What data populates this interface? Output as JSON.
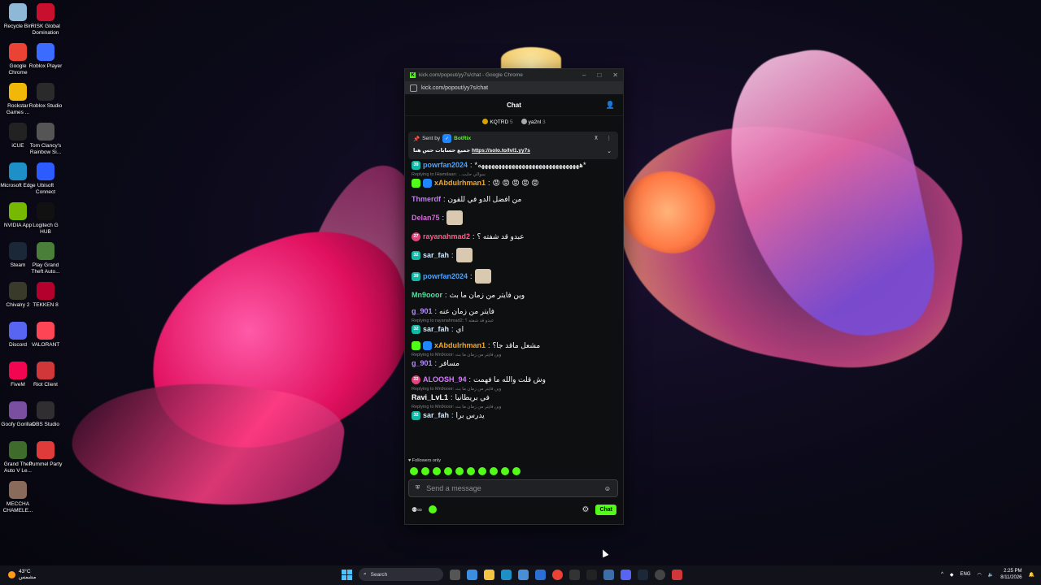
{
  "desktop_icons": [
    {
      "label": "Recycle Bin",
      "color": "#8fb7d6"
    },
    {
      "label": "RISK Global Domination",
      "color": "#c8102e"
    },
    {
      "label": "Google Chrome",
      "color": "#ea4335"
    },
    {
      "label": "Roblox Player",
      "color": "#3b6cff"
    },
    {
      "label": "Rockstar Games ...",
      "color": "#f2b807"
    },
    {
      "label": "Roblox Studio",
      "color": "#2a2a2a"
    },
    {
      "label": "iCUE",
      "color": "#222"
    },
    {
      "label": "Tom Clancy's Rainbow Si...",
      "color": "#555"
    },
    {
      "label": "Microsoft Edge",
      "color": "#1e90c8"
    },
    {
      "label": "Ubisoft Connect",
      "color": "#2c5cff"
    },
    {
      "label": "NVIDIA App",
      "color": "#76b900"
    },
    {
      "label": "Logitech G HUB",
      "color": "#111"
    },
    {
      "label": "Steam",
      "color": "#1b2838"
    },
    {
      "label": "Play Grand Theft Auto...",
      "color": "#4a7f3a"
    },
    {
      "label": "Chivalry 2",
      "color": "#3a3a2a"
    },
    {
      "label": "TEKKEN 8",
      "color": "#b3002d"
    },
    {
      "label": "Discord",
      "color": "#5865f2"
    },
    {
      "label": "VALORANT",
      "color": "#fd4556"
    },
    {
      "label": "FiveM",
      "color": "#f40552"
    },
    {
      "label": "Riot Client",
      "color": "#d13639"
    },
    {
      "label": "Goofy Gorillas",
      "color": "#7a4ea0"
    },
    {
      "label": "OBS Studio",
      "color": "#302e31"
    },
    {
      "label": "Grand Theft Auto V Le...",
      "color": "#3f6b2c"
    },
    {
      "label": "Pummel Party",
      "color": "#e03b3b"
    },
    {
      "label": "MECCHA CHAMELE...",
      "color": "#8a6a5a"
    }
  ],
  "window": {
    "title": "kick.com/popout/yy7s/chat - Google Chrome",
    "url": "kick.com/popout/yy7s/chat",
    "chat_title": "Chat"
  },
  "top_gifters": [
    {
      "name": "KQTRD",
      "count": "5"
    },
    {
      "name": "ya2nl",
      "count": "3"
    }
  ],
  "pinned": {
    "sent_by_label": "Sent by",
    "bot": "BotRix",
    "text": "جميع حسابات حس هنا",
    "link": "https://solo.to/lvl1.yy7s"
  },
  "messages": [
    {
      "badge": "39",
      "badge_type": "teal",
      "user": "powrfan2024",
      "color": "#4aa3ff",
      "text": "*ههههههههههههههههههههههههههههههه*",
      "reply": ""
    },
    {
      "badge": "",
      "badge_type": "green",
      "user": "xAbdulrhman1",
      "color": "#f5a623",
      "text": "😡 😡 😡 😡 😡",
      "reply": "Replying to IHamdaan: ...سوالي حايت"
    },
    {
      "badge": "",
      "badge_type": "",
      "user": "Thmerdf",
      "color": "#c27cf5",
      "text": "من افضل الدو في للفون",
      "reply": ""
    },
    {
      "badge": "",
      "badge_type": "",
      "user": "Delan75",
      "color": "#d06bd8",
      "text": "",
      "emote": true,
      "reply": ""
    },
    {
      "badge": "27",
      "badge_type": "pink",
      "user": "rayanahmad2",
      "color": "#ff5c8a",
      "text": "عبدو قد شفته ؟",
      "reply": ""
    },
    {
      "badge": "32",
      "badge_type": "teal",
      "user": "sar_fah",
      "color": "#cfe8ff",
      "text": "",
      "emote": true,
      "reply": ""
    },
    {
      "badge": "39",
      "badge_type": "teal",
      "user": "powrfan2024",
      "color": "#4aa3ff",
      "text": "",
      "emote": true,
      "reply": ""
    },
    {
      "badge": "",
      "badge_type": "",
      "user": "Mn9ooor",
      "color": "#4fe0a0",
      "text": "وين فايتر من زمان ما بث",
      "reply": ""
    },
    {
      "badge": "",
      "badge_type": "",
      "user": "g_901",
      "color": "#b58cff",
      "text": "فايتر من زمان عنه",
      "reply": ""
    },
    {
      "badge": "32",
      "badge_type": "teal",
      "user": "sar_fah",
      "color": "#cfe8ff",
      "text": "اي",
      "reply": "Replying to rayanahmad2: عبدو قد شفته ؟"
    },
    {
      "badge": "",
      "badge_type": "green",
      "user": "xAbdulrhman1",
      "color": "#f5a623",
      "text": "مشعل ماقد جا؟",
      "reply": ""
    },
    {
      "badge": "",
      "badge_type": "",
      "user": "g_901",
      "color": "#b58cff",
      "text": "مسافر",
      "reply": "Replying to Mn9ooor: وين فايتر من زمان ما بث"
    },
    {
      "badge": "22",
      "badge_type": "pink",
      "user": "ALOOSH_94",
      "color": "#d77bff",
      "text": "وش قلت والله ما فهمت",
      "reply": ""
    },
    {
      "badge": "",
      "badge_type": "",
      "user": "Ravi_LvL1",
      "color": "#ffffff",
      "text": "في بريطانيا",
      "reply": "Replying to Mn9ooor: وين فايتر من زمان ما بث"
    },
    {
      "badge": "32",
      "badge_type": "teal",
      "user": "sar_fah",
      "color": "#cfe8ff",
      "text": "يدرس برا",
      "reply": "Replying to Mn9ooor: وين فايتر من زمان ما بث"
    }
  ],
  "followers_only": "Followers only",
  "input": {
    "placeholder": "Send a message"
  },
  "chat_button": "Chat",
  "infinity_label": "∞",
  "taskbar": {
    "temp": "43°C",
    "weather_desc": "مشمس",
    "search": "Search",
    "lang": "ENG",
    "time": "2:25 PM",
    "date": "8/11/2026"
  }
}
